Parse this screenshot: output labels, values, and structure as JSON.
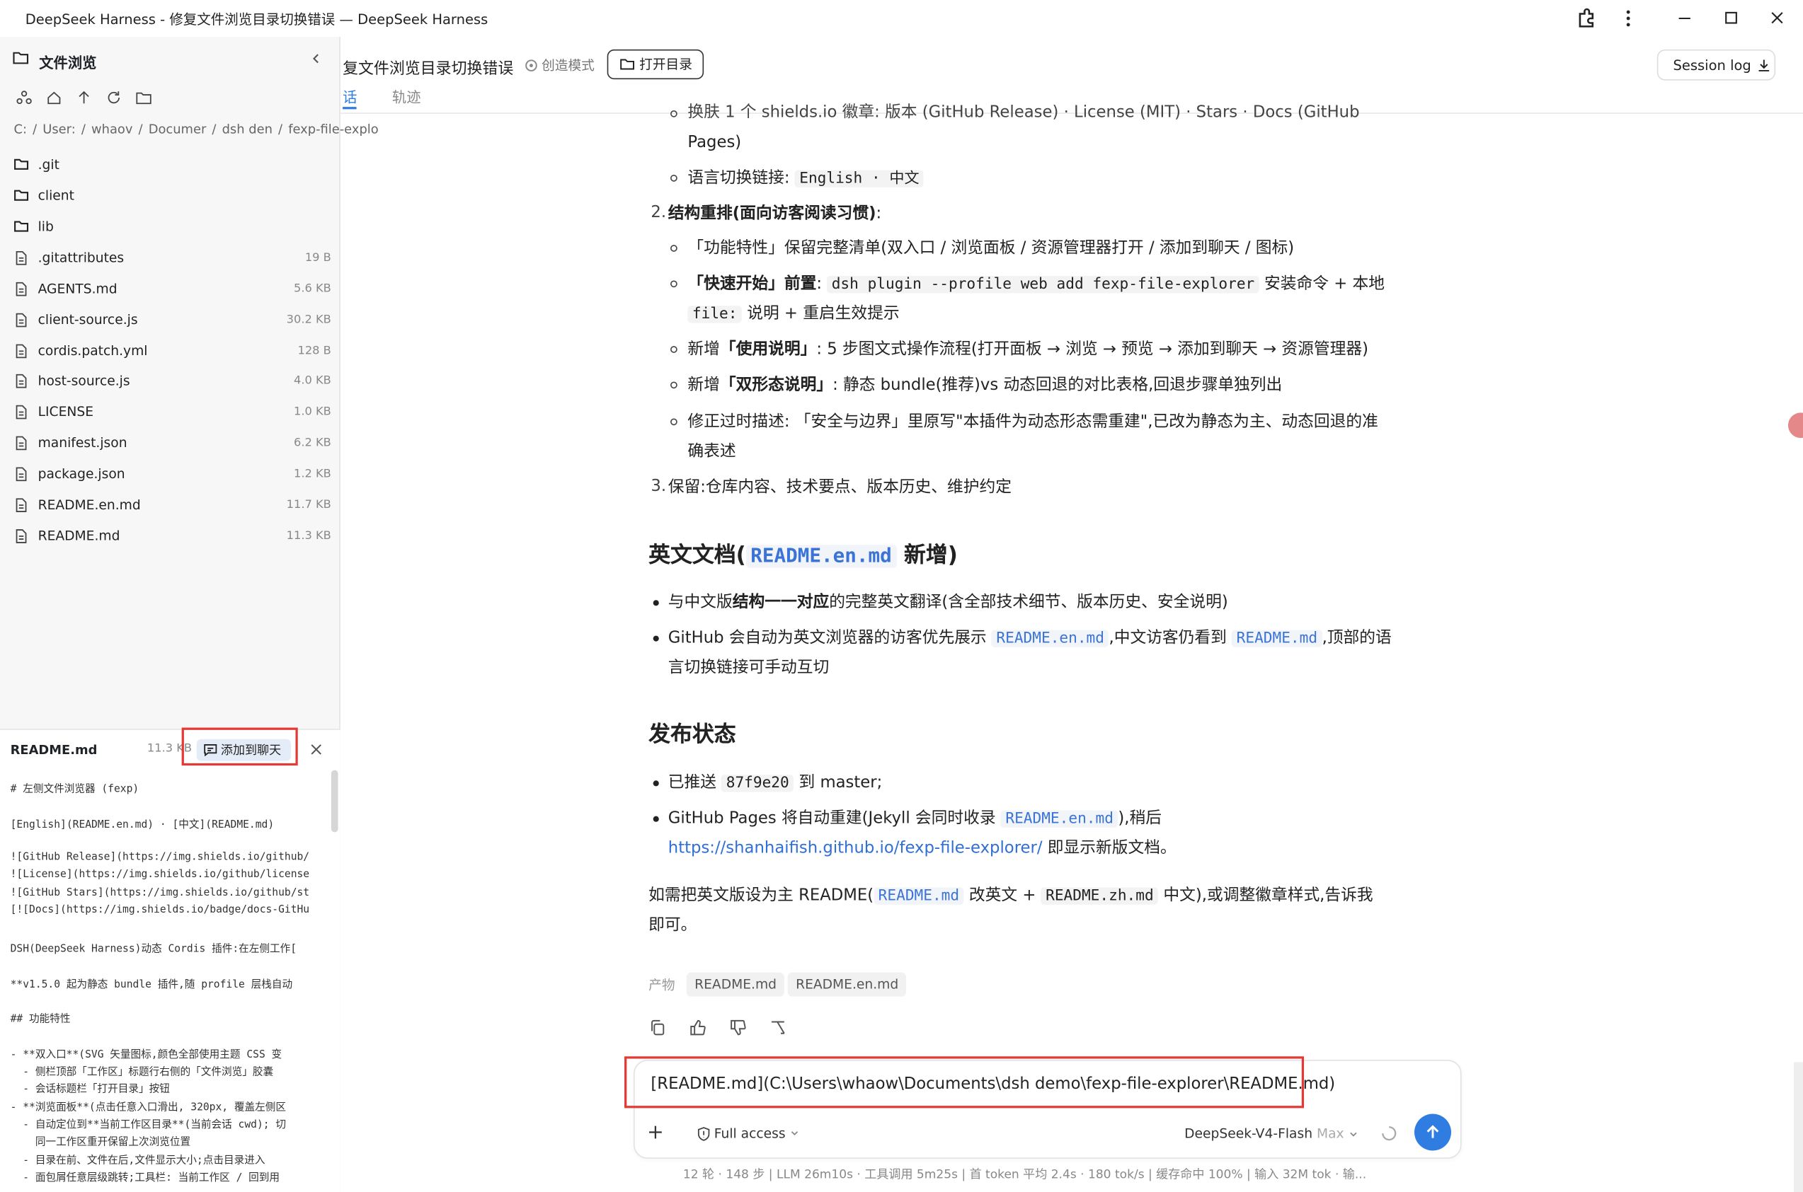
{
  "window": {
    "title": "DeepSeek Harness - 修复文件浏览目录切换错误 — DeepSeek Harness"
  },
  "header": {
    "chat_title": "复文件浏览目录切换错误",
    "mode": "创造模式",
    "open_dir": "打开目录",
    "session_log": "Session log",
    "tabs": [
      "话",
      "轨迹"
    ]
  },
  "sidebar": {
    "title": "文件浏览",
    "breadcrumb": [
      "C:",
      "/",
      "User:",
      "/",
      "whaov",
      "/",
      "Documer",
      "/",
      "dsh den",
      "/",
      "fexp-file-explo"
    ],
    "files": [
      {
        "name": ".git",
        "size": "",
        "icon": "folder-icon"
      },
      {
        "name": "client",
        "size": "",
        "icon": "folder-icon"
      },
      {
        "name": "lib",
        "size": "",
        "icon": "folder-icon"
      },
      {
        "name": ".gitattributes",
        "size": "19 B",
        "icon": "file-icon"
      },
      {
        "name": "AGENTS.md",
        "size": "5.6 KB",
        "icon": "file-icon"
      },
      {
        "name": "client-source.js",
        "size": "30.2 KB",
        "icon": "file-icon"
      },
      {
        "name": "cordis.patch.yml",
        "size": "128 B",
        "icon": "file-icon"
      },
      {
        "name": "host-source.js",
        "size": "4.0 KB",
        "icon": "file-icon"
      },
      {
        "name": "LICENSE",
        "size": "1.0 KB",
        "icon": "file-icon"
      },
      {
        "name": "manifest.json",
        "size": "6.2 KB",
        "icon": "file-icon"
      },
      {
        "name": "package.json",
        "size": "1.2 KB",
        "icon": "file-icon"
      },
      {
        "name": "README.en.md",
        "size": "11.7 KB",
        "icon": "file-icon"
      },
      {
        "name": "README.md",
        "size": "11.3 KB",
        "icon": "file-icon"
      }
    ]
  },
  "preview": {
    "file_name": "README.md",
    "file_size": "11.3 KB",
    "add_to_chat": "添加到聊天",
    "lines": [
      "# 左侧文件浏览器 (fexp)",
      "",
      "[English](README.en.md) · [中文](README.md)",
      "",
      "![GitHub Release](https://img.shields.io/github/",
      "![License](https://img.shields.io/github/license",
      "![GitHub Stars](https://img.shields.io/github/st",
      "[![Docs](https://img.shields.io/badge/docs-GitHu",
      "",
      "DSH(DeepSeek Harness)动态 Cordis 插件:在左侧工作[",
      "",
      "**v1.5.0 起为静态 bundle 插件,随 profile 层栈自动",
      "",
      "## 功能特性",
      "",
      "- **双入口**(SVG 矢量图标,颜色全部使用主题 CSS 变",
      "  - 侧栏顶部「工作区」标题行右侧的「文件浏览」胶囊",
      "  - 会话标题栏「打开目录」按钮",
      "- **浏览面板**(点击任意入口滑出, 320px, 覆盖左侧区",
      "  - 自动定位到**当前工作区目录**(当前会话 cwd); 切",
      "    同一工作区重开保留上次浏览位置",
      "  - 目录在前、文件在后,文件显示大小;点击目录进入",
      "  - 面包屑任意层级跳转;工具栏: 当前工作区 / 回到用"
    ]
  },
  "content": {
    "frag1": "换肤 1 个 shields.io 徽章: 版本 (GitHub Release) · License (MIT) · Stars · Docs (GitHub",
    "frag1b": "Pages)",
    "lang_pre": "语言切换链接:",
    "lang_code": "English · 中文",
    "s2_num": "2.",
    "s2_title": "结构重排(面向访客阅读习惯)",
    "s2_colon": ":",
    "s2_items": {
      "a": "「功能特性」保留完整清单(双入口 / 浏览面板 / 资源管理器打开 / 添加到聊天 / 图标)",
      "b_bold": "「快速开始」前置",
      "b_colon": ":",
      "b_code": "dsh plugin --profile web add fexp-file-explorer",
      "b_rest": "安装命令 + 本地",
      "b_code2": "file:",
      "b_rest2": "说明 + 重启生效提示",
      "c_pre": "新增",
      "c_bold": "「使用说明」",
      "c_rest": ": 5 步图文式操作流程(打开面板 → 浏览 → 预览 → 添加到聊天 → 资源管理器)",
      "d_pre": "新增",
      "d_bold": "「双形态说明」",
      "d_rest": ": 静态 bundle(推荐)vs 动态回退的对比表格,回退步骤单独列出",
      "e1": "修正过时描述: 「安全与边界」里原写\"本插件为动态形态需重建\",已改为静态为主、动态回退的准",
      "e2": "确表述"
    },
    "s3_num": "3.",
    "s3": "保留:仓库内容、技术要点、版本历史、维护约定",
    "h_en_pre": "英文文档(",
    "h_en_code": "README.en.md",
    "h_en_post": "新增)",
    "en_b1_pre": "与中文版",
    "en_b1_bold": "结构一一对应",
    "en_b1_post": "的完整英文翻译(含全部技术细节、版本历史、安全说明)",
    "en_b2_pre": "GitHub 会自动为英文浏览器的访客优先展示",
    "en_b2_code1": "README.en.md",
    "en_b2_mid": ",中文访客仍看到",
    "en_b2_code2": "README.md",
    "en_b2_post": ",顶部的语",
    "en_b2_line2": "言切换链接可手动互切",
    "h_pub": "发布状态",
    "pub_b1_pre": "已推送",
    "pub_b1_code": "87f9e20",
    "pub_b1_post": "到 master;",
    "pub_b2_pre": "GitHub Pages 将自动重建(Jekyll 会同时收录",
    "pub_b2_code": "README.en.md",
    "pub_b2_post": "),稍后",
    "pub_link": "https://shanhaifish.github.io/fexp-file-explorer/",
    "pub_link_post": "即显示新版文档。",
    "final1_pre": "如需把英文版设为主 README(",
    "final1_code1": "README.md",
    "final1_mid": "改英文 +",
    "final1_code2": "README.zh.md",
    "final1_post": "中文),或调整徽章样式,告诉我",
    "final2": "即可。",
    "artifacts_label": "产物",
    "artifacts": [
      "README.md",
      "README.en.md"
    ]
  },
  "composer": {
    "input_value": "[README.md](C:\\Users\\whaow\\Documents\\dsh demo\\fexp-file-explorer\\README.md)",
    "access": "Full access",
    "model": "DeepSeek-V4-Flash",
    "model_level": "Max"
  },
  "status_bar": "12 轮 · 148 步  |  LLM 26m10s · 工具调用 5m25s  |  首 token 平均 2.4s · 180 tok/s  |  缓存命中 100%  |  输入 32M tok · 输...",
  "colors": {
    "accent": "#2f7de1",
    "highlight": "#e53935"
  }
}
